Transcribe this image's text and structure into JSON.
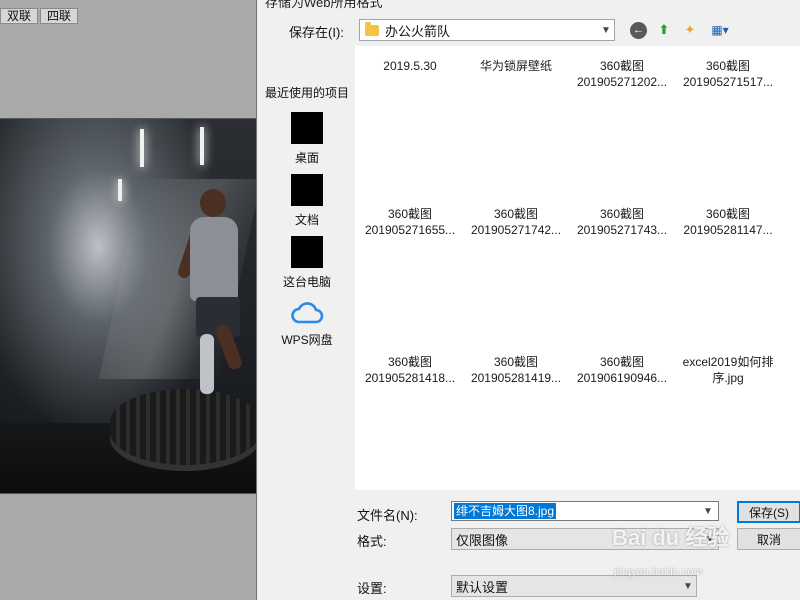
{
  "background_app": {
    "tabs": [
      "双联",
      "四联"
    ]
  },
  "dialog": {
    "title": "存储为Web所用格式",
    "save_in_label": "保存在(I):",
    "current_folder": "办公火箭队",
    "toolbar": {
      "back": "←",
      "up": "⬆",
      "new_folder": "✦",
      "view": "▦▾"
    },
    "places": {
      "recent": "最近使用的项目",
      "desktop": "桌面",
      "documents": "文档",
      "this_pc": "这台电脑",
      "wps": "WPS网盘"
    },
    "files": [
      {
        "line1": "2019.5.30",
        "line2": ""
      },
      {
        "line1": "华为锁屏壁纸",
        "line2": ""
      },
      {
        "line1": "360截图",
        "line2": "201905271202..."
      },
      {
        "line1": "360截图",
        "line2": "201905271517..."
      },
      {
        "line1": "360截图",
        "line2": "201905271655..."
      },
      {
        "line1": "360截图",
        "line2": "201905271742..."
      },
      {
        "line1": "360截图",
        "line2": "201905271743..."
      },
      {
        "line1": "360截图",
        "line2": "201905281147..."
      },
      {
        "line1": "360截图",
        "line2": "201905281418..."
      },
      {
        "line1": "360截图",
        "line2": "201905281419..."
      },
      {
        "line1": "360截图",
        "line2": "201906190946..."
      },
      {
        "line1": "excel2019如何排",
        "line2": "序.jpg"
      }
    ],
    "filename_label": "文件名(N):",
    "filename_value": "绯不吉姆大图8.jpg",
    "format_label": "格式:",
    "format_value": "仅限图像",
    "settings_label": "设置:",
    "settings_value": "默认设置",
    "save_button": "保存(S)",
    "cancel_button": "取消"
  },
  "watermark": {
    "text": "Bai du 经验",
    "sub": "jingyan.baidu.com"
  },
  "colors": {
    "selection": "#0078d7",
    "dialog_bg": "#f0f0f0",
    "folder": "#f2c446",
    "cloud": "#2b8be8"
  }
}
